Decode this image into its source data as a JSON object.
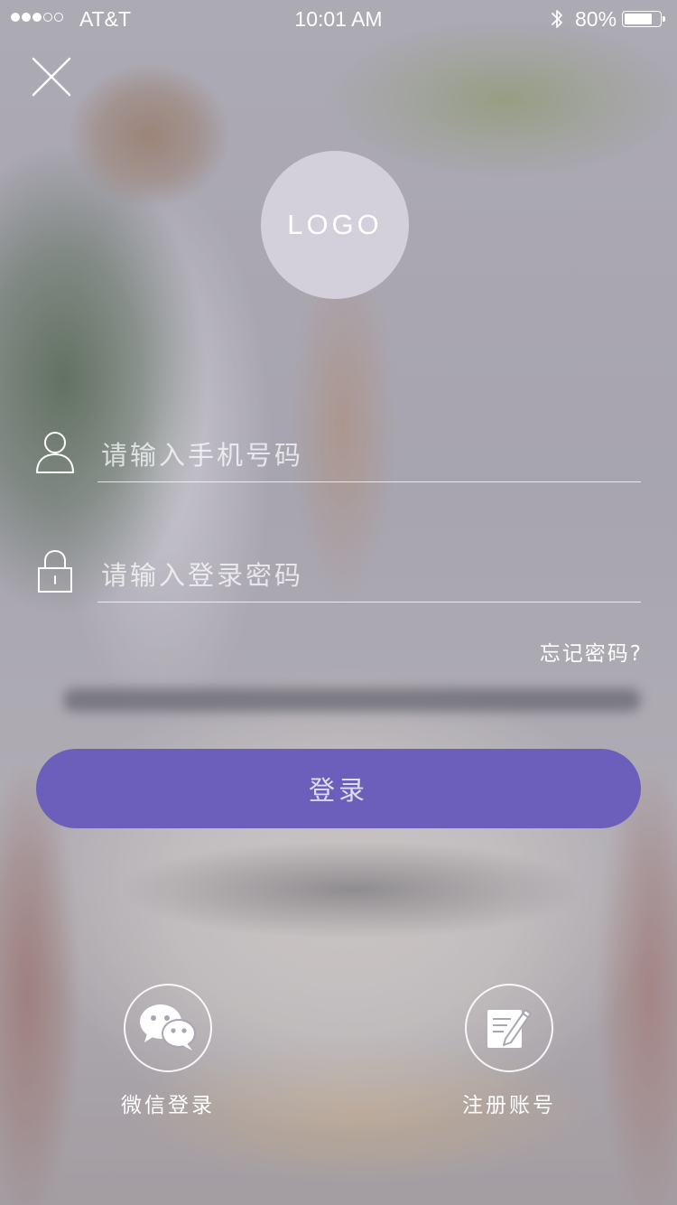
{
  "status_bar": {
    "carrier": "AT&T",
    "time": "10:01 AM",
    "battery_percent": "80%",
    "battery_level": 0.8,
    "signal_bars_filled": 3,
    "signal_bars_total": 5
  },
  "header": {
    "close_icon": "close-icon"
  },
  "logo": {
    "text": "LOGO"
  },
  "form": {
    "phone": {
      "placeholder": "请输入手机号码",
      "value": "",
      "icon": "user-icon"
    },
    "password": {
      "placeholder": "请输入登录密码",
      "value": "",
      "icon": "lock-icon"
    },
    "forgot_password": "忘记密码?",
    "login_label": "登录"
  },
  "social": {
    "wechat_label": "微信登录",
    "wechat_icon": "wechat-icon",
    "register_label": "注册账号",
    "register_icon": "edit-icon"
  },
  "colors": {
    "accent": "#6c5fbb",
    "logo_bg": "#d3d0dc"
  }
}
